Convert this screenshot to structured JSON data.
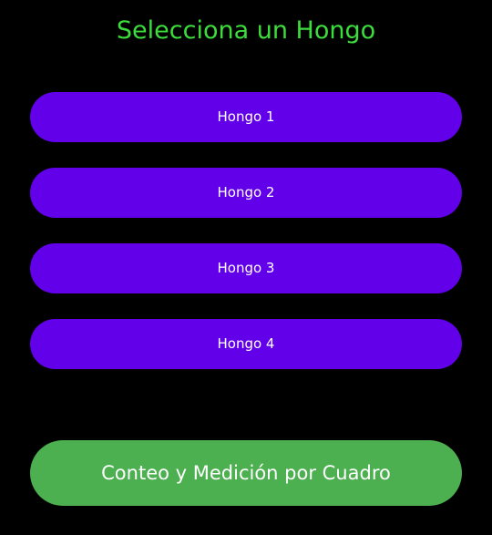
{
  "screen": {
    "title": "Selecciona un Hongo"
  },
  "mushrooms": [
    {
      "label": "Hongo 1"
    },
    {
      "label": "Hongo 2"
    },
    {
      "label": "Hongo 3"
    },
    {
      "label": "Hongo 4"
    }
  ],
  "actions": {
    "count_label": "Conteo y Medición por Cuadro"
  },
  "colors": {
    "background": "#000000",
    "title": "#3ddc3d",
    "mushroom_button": "#6200ea",
    "count_button": "#4caf50",
    "button_text": "#ffffff"
  }
}
